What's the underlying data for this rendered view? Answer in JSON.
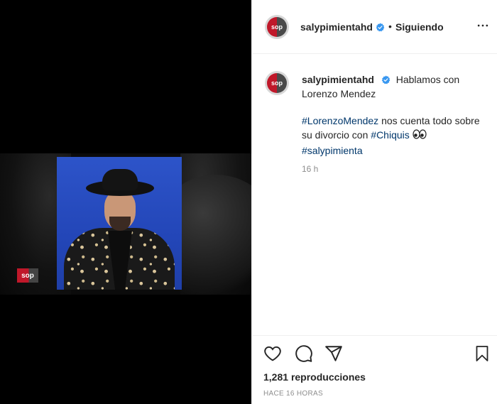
{
  "media": {
    "logo_text": "sop"
  },
  "header": {
    "avatar_text": "sop",
    "username": "salypimientahd",
    "verified_icon": "verified-badge-icon",
    "separator": "•",
    "follow_status": "Siguiendo",
    "more_icon": "more-options-icon"
  },
  "caption": {
    "avatar_text": "sop",
    "username": "salypimientahd",
    "intro": "Hablamos con Lorenzo Mendez",
    "hashtag1": "#LorenzoMendez",
    "text1": " nos cuenta todo sobre su divorcio con ",
    "hashtag2": "#Chiquis",
    "emoji_icon": "eyes-emoji-icon",
    "hashtag3": "#salypimienta",
    "time_ago": "16 h"
  },
  "actions": {
    "like_icon": "heart-icon",
    "comment_icon": "comment-icon",
    "share_icon": "share-icon",
    "save_icon": "bookmark-icon",
    "views_count": "1,281",
    "views_label": "reproducciones",
    "posted_time": "HACE 16 HORAS"
  },
  "colors": {
    "hashtag": "#00376b",
    "verified": "#3897f0",
    "brand_red": "#c0182a",
    "muted": "#8e8e8e"
  }
}
